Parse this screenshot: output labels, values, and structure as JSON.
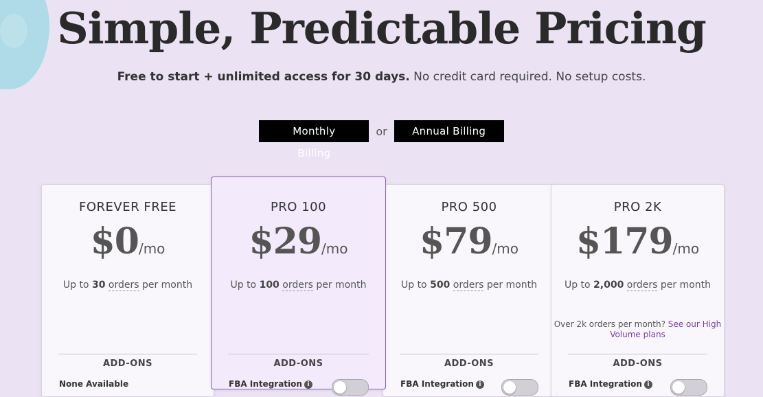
{
  "header": {
    "title": "Simple, Predictable Pricing",
    "subtitle_bold": "Free to start + unlimited access for 30 days.",
    "subtitle_rest": " No credit card required. No setup costs."
  },
  "billing": {
    "monthly_label": "Monthly Billing",
    "or_label": "or",
    "annual_label": "Annual Billing"
  },
  "plans": [
    {
      "name": "FOREVER FREE",
      "price": "$0",
      "per": "/mo",
      "orders_prefix": "Up to ",
      "orders_count": "30",
      "orders_word": "orders",
      "orders_suffix": " per month",
      "addons_heading": "ADD-ONS",
      "addon": "None Available"
    },
    {
      "name": "PRO 100",
      "price": "$29",
      "per": "/mo",
      "orders_prefix": "Up to ",
      "orders_count": "100",
      "orders_word": "orders",
      "orders_suffix": " per month",
      "addons_heading": "ADD-ONS",
      "addon": "FBA Integration"
    },
    {
      "name": "PRO 500",
      "price": "$79",
      "per": "/mo",
      "orders_prefix": "Up to ",
      "orders_count": "500",
      "orders_word": "orders",
      "orders_suffix": " per month",
      "addons_heading": "ADD-ONS",
      "addon": "FBA Integration"
    },
    {
      "name": "PRO 2K",
      "price": "$179",
      "per": "/mo",
      "orders_prefix": "Up to ",
      "orders_count": "2,000",
      "orders_word": "orders",
      "orders_suffix": " per month",
      "extra_text": "Over 2k orders per month? ",
      "extra_link": "See our High Volume plans",
      "addons_heading": "ADD-ONS",
      "addon": "FBA Integration"
    }
  ],
  "info_icon_glyph": "i"
}
